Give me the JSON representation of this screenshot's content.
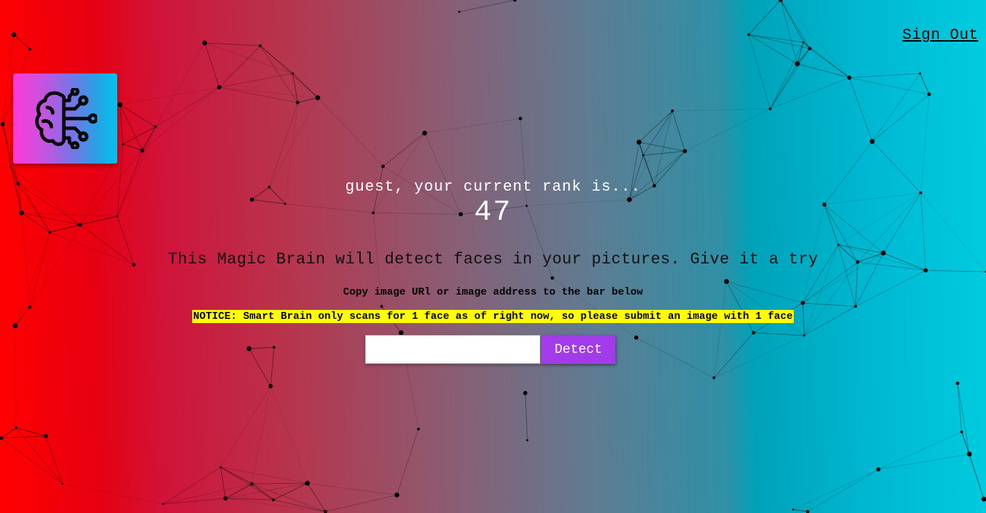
{
  "nav": {
    "sign_out_label": "Sign Out"
  },
  "logo": {
    "icon": "brain-circuit-icon"
  },
  "rank": {
    "message": "guest, your current rank is...",
    "value": "47"
  },
  "main": {
    "intro": "This Magic Brain will detect faces in your pictures. Give it a try",
    "instruction": "Copy image URl or image address to the bar below",
    "notice": "NOTICE: Smart Brain only scans for 1 face as of right now, so please submit an image with 1 face"
  },
  "form": {
    "url_value": "",
    "button_label": "Detect"
  },
  "colors": {
    "button": "#a23bea",
    "notice_highlight": "#ffff00",
    "gradient_left": "#ff0000",
    "gradient_right": "#00ccdf"
  }
}
